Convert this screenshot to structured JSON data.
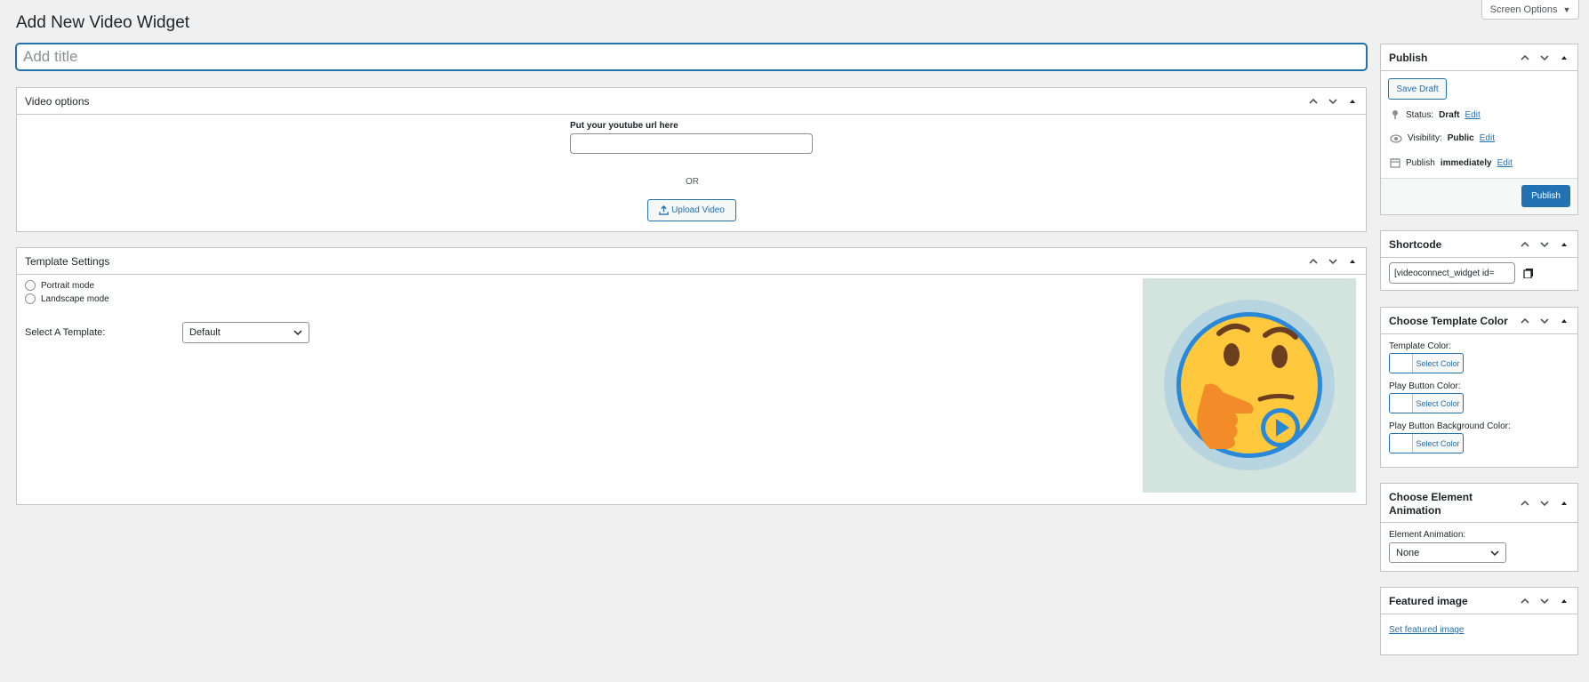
{
  "page": {
    "title": "Add New Video Widget",
    "title_placeholder": "Add title"
  },
  "screen_options": {
    "label": "Screen Options",
    "arrow": "▼"
  },
  "video_options": {
    "title": "Video options",
    "url_label": "Put your youtube url here",
    "url_value": "",
    "or_text": "OR",
    "upload_label": "Upload Video"
  },
  "template_settings": {
    "title": "Template Settings",
    "portrait_label": "Portrait mode",
    "landscape_label": "Landscape mode",
    "select_label": "Select A Template:",
    "select_value": "Default"
  },
  "publish": {
    "title": "Publish",
    "save_draft": "Save Draft",
    "status_label": "Status:",
    "status_value": "Draft",
    "visibility_label": "Visibility:",
    "visibility_value": "Public",
    "publish_label": "Publish",
    "publish_value": "immediately",
    "edit": "Edit",
    "publish_button": "Publish"
  },
  "shortcode": {
    "title": "Shortcode",
    "value": "[videoconnect_widget id="
  },
  "template_color": {
    "title": "Choose Template Color",
    "template_color_label": "Template Color:",
    "play_button_color_label": "Play Button Color:",
    "play_button_bg_label": "Play Button Background Color:",
    "select_color": "Select Color"
  },
  "element_animation": {
    "title_line1": "Choose Element",
    "title_line2": "Animation",
    "label": "Element Animation:",
    "value": "None"
  },
  "featured_image": {
    "title": "Featured image",
    "link": "Set featured image"
  },
  "colors": {
    "accent": "#2271b1",
    "background": "#f0f0f1",
    "preview_bg": "#d3e4de",
    "emoji": "#ffc83d"
  }
}
